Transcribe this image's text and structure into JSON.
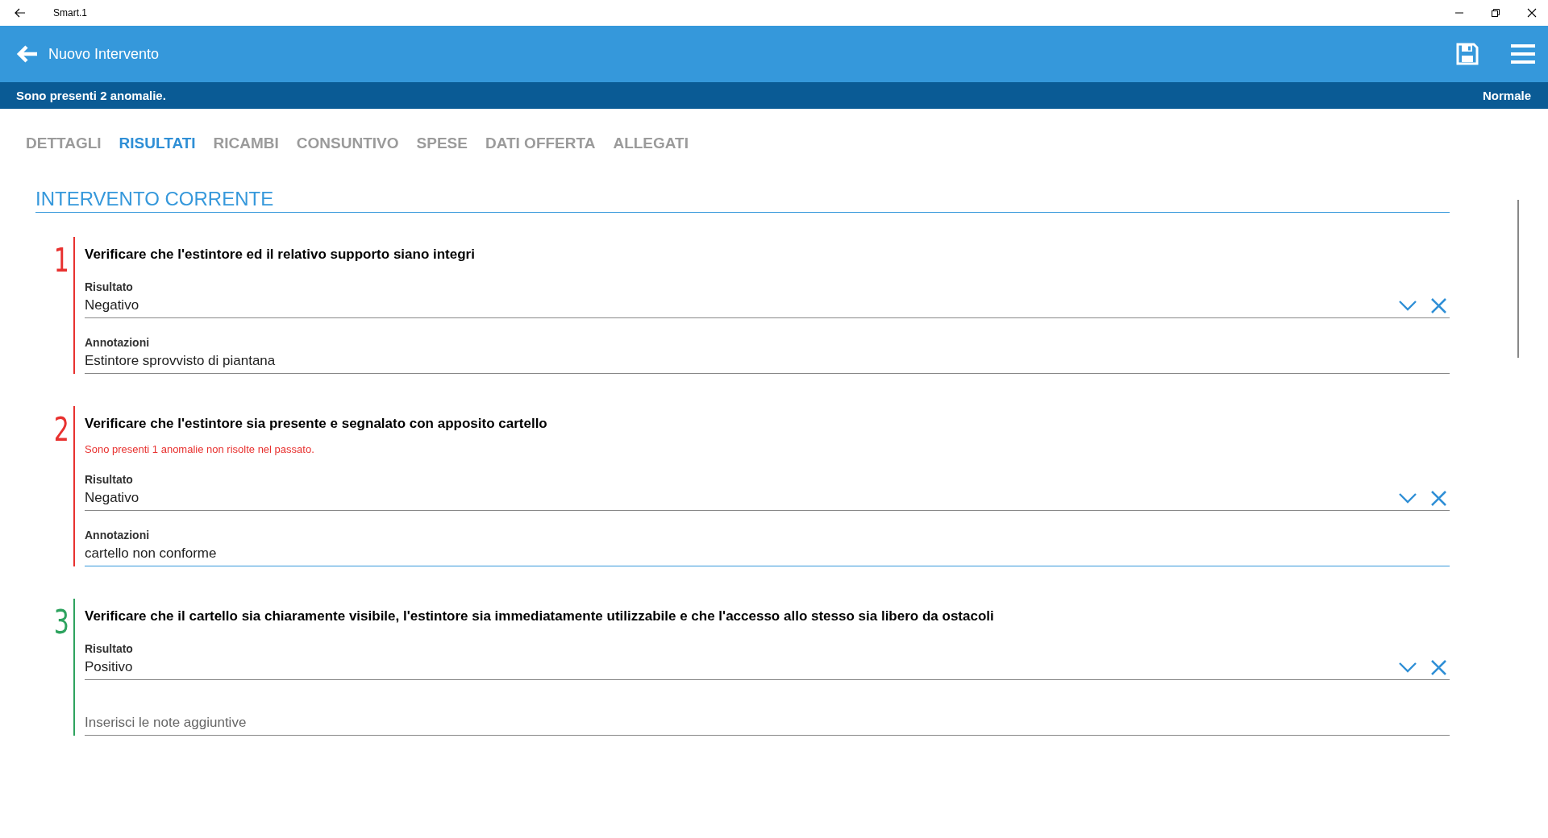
{
  "window": {
    "title": "Smart.1"
  },
  "header": {
    "title": "Nuovo Intervento"
  },
  "status_bar": {
    "message": "Sono presenti 2 anomalie.",
    "priority": "Normale"
  },
  "tabs": [
    {
      "label": "DETTAGLI",
      "selected": false
    },
    {
      "label": "RISULTATI",
      "selected": true
    },
    {
      "label": "RICAMBI",
      "selected": false
    },
    {
      "label": "CONSUNTIVO",
      "selected": false
    },
    {
      "label": "SPESE",
      "selected": false
    },
    {
      "label": "DATI OFFERTA",
      "selected": false
    },
    {
      "label": "ALLEGATI",
      "selected": false
    }
  ],
  "section": {
    "title": "INTERVENTO CORRENTE"
  },
  "checks": [
    {
      "number": "1",
      "color": "#e8312f",
      "question": "Verificare che l'estintore ed il relativo supporto siano integri",
      "result": {
        "label": "Risultato",
        "value": "Negativo"
      },
      "notes": {
        "label": "Annotazioni",
        "value": "Estintore sprovvisto di piantana",
        "focused": false
      }
    },
    {
      "number": "2",
      "color": "#e8312f",
      "question": "Verificare che l'estintore sia presente e segnalato con apposito cartello",
      "warning": "Sono presenti 1 anomalie non risolte nel passato.",
      "result": {
        "label": "Risultato",
        "value": "Negativo"
      },
      "notes": {
        "label": "Annotazioni",
        "value": "cartello non conforme",
        "focused": true
      }
    },
    {
      "number": "3",
      "color": "#2ea35f",
      "question": "Verificare che il cartello sia chiaramente visibile, l'estintore sia immediatamente utilizzabile e che l'accesso allo stesso sia libero da ostacoli",
      "result": {
        "label": "Risultato",
        "value": "Positivo"
      },
      "notes": {
        "placeholder": "Inserisci le note aggiuntive",
        "focused": false
      }
    }
  ]
}
